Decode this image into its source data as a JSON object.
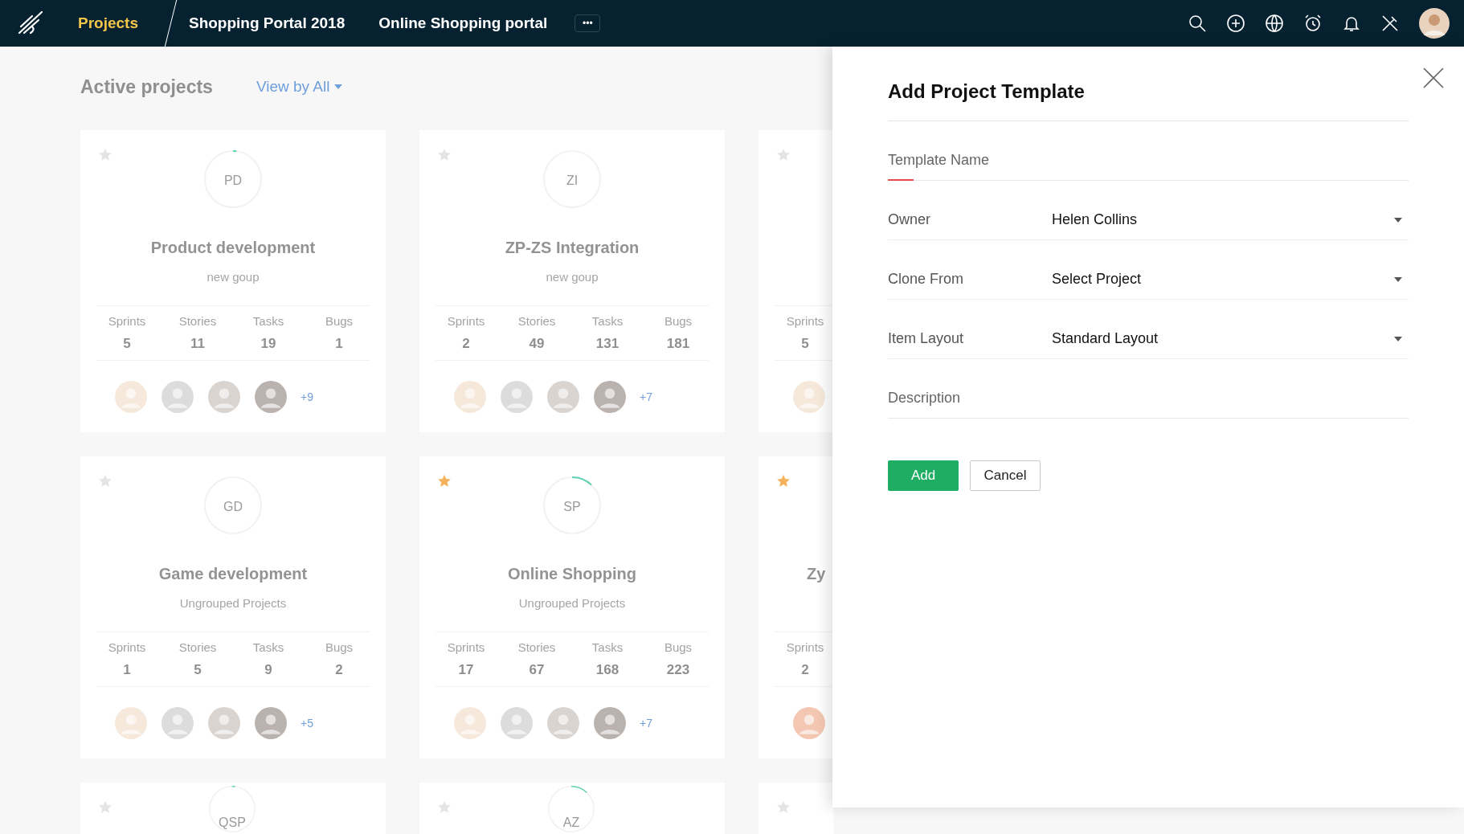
{
  "topbar": {
    "section": "Projects",
    "tabs": [
      "Shopping Portal 2018",
      "Online Shopping portal"
    ],
    "more": "•••"
  },
  "page": {
    "title": "Active projects",
    "filter": "View by All"
  },
  "cards": [
    {
      "starred": false,
      "initials": "PD",
      "level": 0.02,
      "name": "Product development",
      "group": "new goup",
      "stats": [
        {
          "label": "Sprints",
          "value": "5"
        },
        {
          "label": "Stories",
          "value": "11"
        },
        {
          "label": "Tasks",
          "value": "19"
        },
        {
          "label": "Bugs",
          "value": "1"
        }
      ],
      "more": "+9"
    },
    {
      "starred": false,
      "initials": "ZI",
      "level": 0,
      "name": "ZP-ZS Integration",
      "group": "new goup",
      "stats": [
        {
          "label": "Sprints",
          "value": "2"
        },
        {
          "label": "Stories",
          "value": "49"
        },
        {
          "label": "Tasks",
          "value": "131"
        },
        {
          "label": "Bugs",
          "value": "181"
        }
      ],
      "more": "+7"
    },
    {
      "starred": false,
      "stats": [
        {
          "label": "Sprints",
          "value": "5"
        }
      ]
    },
    {
      "starred": false,
      "initials": "GD",
      "level": 0,
      "name": "Game development",
      "group": "Ungrouped Projects",
      "stats": [
        {
          "label": "Sprints",
          "value": "1"
        },
        {
          "label": "Stories",
          "value": "5"
        },
        {
          "label": "Tasks",
          "value": "9"
        },
        {
          "label": "Bugs",
          "value": "2"
        }
      ],
      "more": "+5"
    },
    {
      "starred": true,
      "initials": "SP",
      "level": 0.12,
      "name": "Online Shopping",
      "group": "Ungrouped Projects",
      "stats": [
        {
          "label": "Sprints",
          "value": "17"
        },
        {
          "label": "Stories",
          "value": "67"
        },
        {
          "label": "Tasks",
          "value": "168"
        },
        {
          "label": "Bugs",
          "value": "223"
        }
      ],
      "more": "+7"
    },
    {
      "starred": true,
      "name": "Zy",
      "stats": [
        {
          "label": "Sprints",
          "value": "2"
        }
      ]
    },
    {
      "starred": false,
      "initials": "QSP",
      "level": 0.02
    },
    {
      "starred": false,
      "initials": "AZ",
      "level": 0.12
    },
    {
      "starred": false
    }
  ],
  "dialog": {
    "title": "Add Project Template",
    "template_name": {
      "placeholder": "Template Name"
    },
    "fields": [
      {
        "label": "Owner",
        "value": "Helen Collins"
      },
      {
        "label": "Clone From",
        "value": "Select Project"
      },
      {
        "label": "Item Layout",
        "value": "Standard Layout"
      }
    ],
    "description": {
      "placeholder": "Description"
    },
    "buttons": [
      {
        "label": "Add",
        "kind": "primary"
      },
      {
        "label": "Cancel",
        "kind": "secondary"
      }
    ]
  }
}
